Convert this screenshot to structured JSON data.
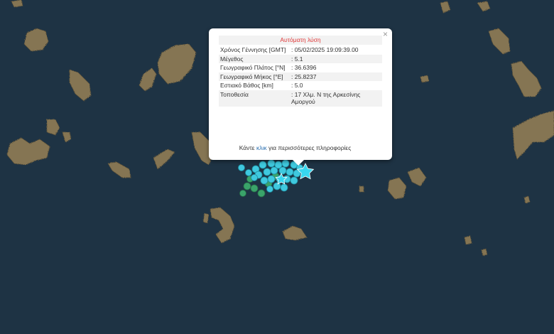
{
  "popup": {
    "title": "Αυτόματη λύση",
    "close_icon": "×",
    "rows": [
      {
        "label": "Χρόνος Γέννησης [GMT]",
        "value": ": 05/02/2025 19:09:39.00"
      },
      {
        "label": "Μέγεθος",
        "value": ": 5.1"
      },
      {
        "label": "Γεωγραφικό Πλάτος [°N]",
        "value": ": 36.6396"
      },
      {
        "label": "Γεωγραφικό Μήκος [°E]",
        "value": ": 25.8237"
      },
      {
        "label": "Εστιακό Βάθος [km]",
        "value": ": 5.0"
      },
      {
        "label": "Τοποθεσία",
        "value": ": 17 Χλμ. Ν της Αρκεσίνης Αμοργού"
      }
    ],
    "more": {
      "before": "Κάντε ",
      "link": "κλικ",
      "after": " για περισσότερες πληροφορίες"
    }
  },
  "colors": {
    "sea": "#1e3344",
    "land": "#8a7a5a",
    "recent_quake": "#3fc9df",
    "older_quake": "#3aa36a",
    "epicenter_star": "#38d7ef",
    "popup_title": "#e03a3a",
    "link": "#2a6fb0"
  }
}
